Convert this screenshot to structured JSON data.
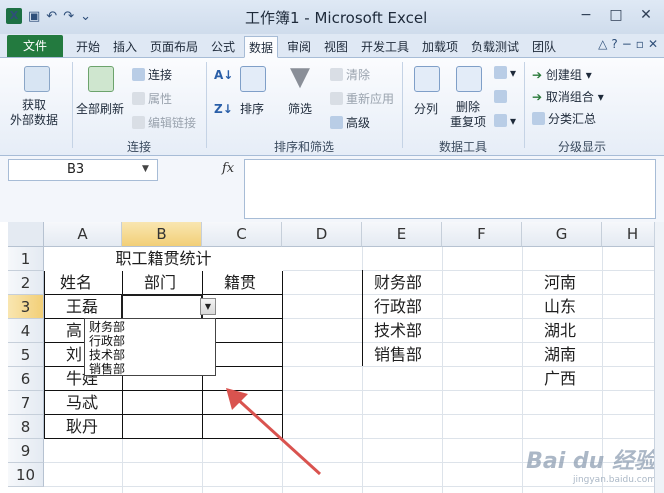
{
  "window": {
    "title": "工作簿1 - Microsoft Excel"
  },
  "tabs": [
    "文件",
    "开始",
    "插入",
    "页面布局",
    "公式",
    "数据",
    "审阅",
    "视图",
    "开发工具",
    "加载项",
    "负载测试",
    "团队"
  ],
  "ribbon": {
    "get_external_data": "获取\n外部数据",
    "refresh_all": "全部刷新",
    "connections": "连接",
    "properties": "属性",
    "edit_links": "编辑链接",
    "group_connections": "连接",
    "sort": "排序",
    "filter": "筛选",
    "clear": "清除",
    "reapply": "重新应用",
    "advanced": "高级",
    "group_sort_filter": "排序和筛选",
    "text_to_columns": "分列",
    "remove_duplicates": "删除\n重复项",
    "group_data_tools": "数据工具",
    "group": "创建组",
    "ungroup": "取消组合",
    "subtotal": "分类汇总",
    "group_outline": "分级显示"
  },
  "formula_bar": {
    "name_box": "B3",
    "fx": "fx",
    "value": ""
  },
  "columns": [
    "A",
    "B",
    "C",
    "D",
    "E",
    "F",
    "G",
    "H"
  ],
  "rows": [
    "1",
    "2",
    "3",
    "4",
    "5",
    "6",
    "7",
    "8",
    "9",
    "10"
  ],
  "sheet": {
    "title": "职工籍贯统计",
    "headers": [
      "姓名",
      "部门",
      "籍贯"
    ],
    "names": [
      "王磊",
      "高",
      "刘",
      "牛娃",
      "马忒",
      "耿丹"
    ],
    "departments": [
      "财务部",
      "行政部",
      "技术部",
      "销售部"
    ],
    "provinces": [
      "河南",
      "山东",
      "湖北",
      "湖南",
      "广西"
    ]
  },
  "dropdown": {
    "options": [
      "财务部",
      "行政部",
      "技术部",
      "销售部"
    ]
  },
  "watermark": {
    "brand": "Bai du 经验",
    "url": "jingyan.baidu.com"
  },
  "colors": {
    "file_tab": "#237a3f",
    "selected_header": "#f2cf77",
    "arrow": "#d9534f"
  }
}
